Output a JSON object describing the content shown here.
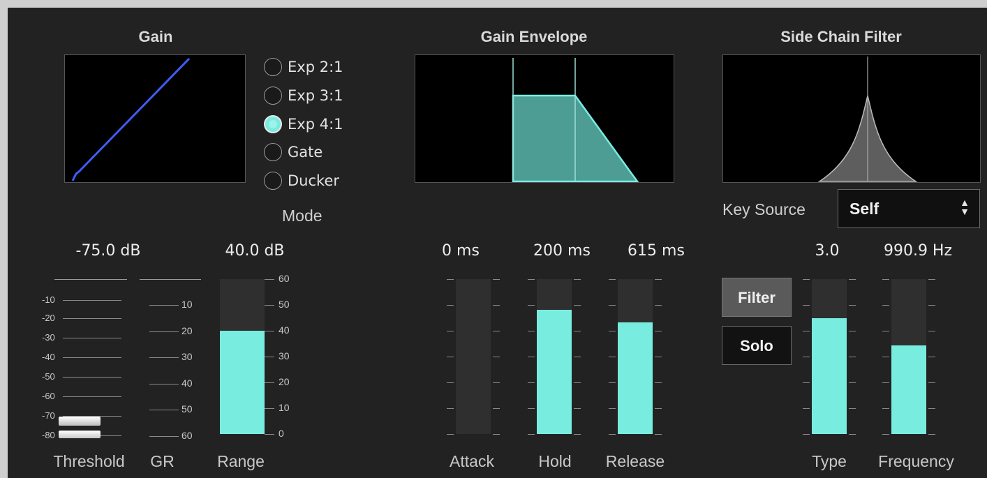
{
  "sections": {
    "gain_title": "Gain",
    "envelope_title": "Gain Envelope",
    "sidechain_title": "Side Chain Filter"
  },
  "mode": {
    "label": "Mode",
    "options": [
      "Exp 2:1",
      "Exp 3:1",
      "Exp 4:1",
      "Gate",
      "Ducker"
    ],
    "selected": "Exp 4:1"
  },
  "gain": {
    "threshold_value": "-75.0 dB",
    "range_value": "40.0 dB",
    "threshold_label": "Threshold",
    "gr_label": "GR",
    "range_label": "Range",
    "threshold_scale": [
      "-10",
      "-20",
      "-30",
      "-40",
      "-50",
      "-60",
      "-70",
      "-80"
    ],
    "gr_scale": [
      "10",
      "20",
      "30",
      "40",
      "50",
      "60"
    ],
    "range_scale": [
      "60",
      "50",
      "40",
      "30",
      "20",
      "10",
      "0"
    ],
    "range_level": 40,
    "range_max": 60
  },
  "envelope": {
    "attack_value": "0 ms",
    "hold_value": "200 ms",
    "release_value": "615 ms",
    "attack_label": "Attack",
    "hold_label": "Hold",
    "release_label": "Release",
    "attack_level": 0,
    "hold_level": 0.8,
    "release_level": 0.72
  },
  "sidechain": {
    "key_source_label": "Key Source",
    "key_source_value": "Self",
    "filter_button": "Filter",
    "solo_button": "Solo",
    "type_value": "3.0",
    "frequency_value": "990.9 Hz",
    "type_label": "Type",
    "frequency_label": "Frequency",
    "type_level": 0.75,
    "frequency_level": 0.57
  },
  "colors": {
    "accent": "#79ece0",
    "curve": "#3c5ef5",
    "panel": "#222222"
  }
}
